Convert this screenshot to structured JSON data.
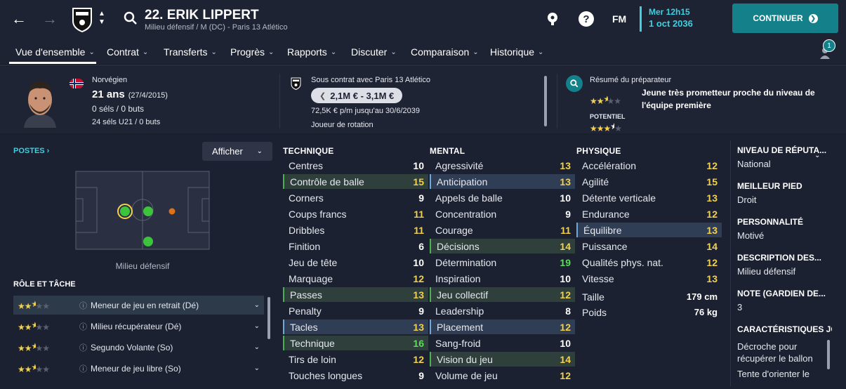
{
  "header": {
    "player_name": "22. ERIK LIPPERT",
    "player_sub": "Milieu défensif / M (DC) - Paris 13 Atlético",
    "fm_label": "FM",
    "date_day": "Mer 12h15",
    "date_full": "1 oct 2036",
    "continue_label": "CONTINUER",
    "notif_count": "1"
  },
  "nav": {
    "items": [
      "Vue d'ensemble",
      "Contrat",
      "Transferts",
      "Progrès",
      "Rapports",
      "Discuter",
      "Comparaison",
      "Historique"
    ]
  },
  "profile": {
    "nationality": "Norvégien",
    "age": "21 ans",
    "dob": "(27/4/2015)",
    "caps": "0 séls / 0 buts",
    "u21": "24 séls U21 / 0 buts"
  },
  "contract": {
    "club_line": "Sous contrat avec Paris 13 Atlético",
    "value": "2,1M € - 3,1M €",
    "wage": "72,5K € p/m jusqu'au 30/6/2039",
    "status": "Joueur de rotation"
  },
  "scout": {
    "title": "Résumé du préparateur",
    "summary": "Jeune très prometteur proche du niveau de l'équipe première",
    "potential_label": "POTENTIEL",
    "ability_stars": 2.5,
    "potential_stars": 3.5
  },
  "positions": {
    "title": "POSTES",
    "show_label": "Afficher",
    "position_caption": "Milieu défensif"
  },
  "roles": {
    "title": "RÔLE ET TÂCHE",
    "items": [
      {
        "label": "Meneur de jeu en retrait (Dé)",
        "stars": 2.5
      },
      {
        "label": "Milieu récupérateur (Dé)",
        "stars": 2.5
      },
      {
        "label": "Segundo Volante (So)",
        "stars": 2.5
      },
      {
        "label": "Meneur de jeu libre (So)",
        "stars": 2.5
      }
    ]
  },
  "attributes": {
    "technique_title": "TECHNIQUE",
    "mental_title": "MENTAL",
    "physique_title": "PHYSIQUE",
    "technique": [
      [
        "Centres",
        "10"
      ],
      [
        "Contrôle de balle",
        "15"
      ],
      [
        "Corners",
        "9"
      ],
      [
        "Coups francs",
        "11"
      ],
      [
        "Dribbles",
        "11"
      ],
      [
        "Finition",
        "6"
      ],
      [
        "Jeu de tête",
        "10"
      ],
      [
        "Marquage",
        "12"
      ],
      [
        "Passes",
        "13"
      ],
      [
        "Penalty",
        "9"
      ],
      [
        "Tacles",
        "13"
      ],
      [
        "Technique",
        "16"
      ],
      [
        "Tirs de loin",
        "12"
      ],
      [
        "Touches longues",
        "9"
      ]
    ],
    "mental": [
      [
        "Agressivité",
        "13"
      ],
      [
        "Anticipation",
        "13"
      ],
      [
        "Appels de balle",
        "10"
      ],
      [
        "Concentration",
        "9"
      ],
      [
        "Courage",
        "11"
      ],
      [
        "Décisions",
        "14"
      ],
      [
        "Détermination",
        "19"
      ],
      [
        "Inspiration",
        "10"
      ],
      [
        "Jeu collectif",
        "12"
      ],
      [
        "Leadership",
        "8"
      ],
      [
        "Placement",
        "12"
      ],
      [
        "Sang-froid",
        "10"
      ],
      [
        "Vision du jeu",
        "14"
      ],
      [
        "Volume de jeu",
        "12"
      ]
    ],
    "physique": [
      [
        "Accélération",
        "12"
      ],
      [
        "Agilité",
        "15"
      ],
      [
        "Détente verticale",
        "13"
      ],
      [
        "Endurance",
        "12"
      ],
      [
        "Équilibre",
        "13"
      ],
      [
        "Puissance",
        "14"
      ],
      [
        "Qualités phys. nat.",
        "12"
      ],
      [
        "Vitesse",
        "13"
      ]
    ],
    "height_label": "Taille",
    "height": "179 cm",
    "weight_label": "Poids",
    "weight": "76 kg"
  },
  "info": {
    "rep_label": "NIVEAU DE RÉPUTA...",
    "rep_value": "National",
    "foot_label": "MEILLEUR PIED",
    "foot_value": "Droit",
    "pers_label": "PERSONNALITÉ",
    "pers_value": "Motivé",
    "desc_label": "DESCRIPTION DES...",
    "desc_value": "Milieu défensif",
    "gk_label": "NOTE (GARDIEN DE...",
    "gk_value": "3",
    "traits_label": "CARACTÉRISTIQUES JO",
    "traits": [
      "Décroche pour récupérer le ballon",
      "Tente d'orienter le"
    ]
  }
}
